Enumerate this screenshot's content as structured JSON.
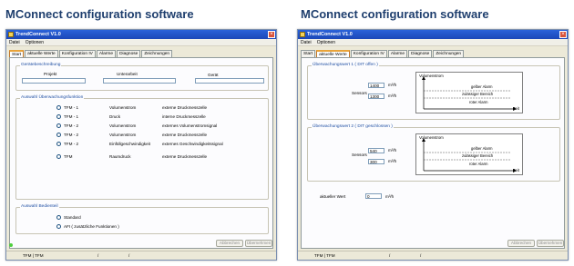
{
  "headings": {
    "left": "MConnect configuration software",
    "right": "MConnect configuration software"
  },
  "app": {
    "title": "TrendConnect V1.0",
    "menu": [
      "Datei",
      "Optionen"
    ],
    "tabs": [
      "Start",
      "aktuelle Werte",
      "Konfiguration IV",
      "Alarme",
      "Diagnose",
      "Zeichnungen"
    ]
  },
  "left": {
    "active_tab": "Start",
    "device_group": {
      "title": "Gerätebeschreibung",
      "fields": [
        {
          "label": "Projekt",
          "value": ""
        },
        {
          "label": "Unterarbeit",
          "value": ""
        },
        {
          "label": "Gerät",
          "value": ""
        }
      ]
    },
    "transducer_group": {
      "title": "Auswahl Überwachungsfunktion",
      "rows": [
        {
          "option": "TFM - 1",
          "type": "Volumenstrom",
          "source": "externe Druckmesszelle"
        },
        {
          "option": "TFM - 1",
          "type": "Druck",
          "source": "interne Druckmesszelle"
        },
        {
          "option": "TFM - 2",
          "type": "Volumenstrom",
          "source": "externes Volumenstromsignal"
        },
        {
          "option": "TFM - 2",
          "type": "Volumenstrom",
          "source": "externe Druckmesszelle"
        },
        {
          "option": "TFM - 2",
          "type": "Einfüllgeschwindigkeit",
          "source": "externes Geschwindigkeitssignal"
        },
        {
          "option": "TFM",
          "type": "Raumdruck",
          "source": "externe Druckmesszelle"
        }
      ]
    },
    "operation_group": {
      "title": "Auswahl Bedienteil",
      "options": [
        "Standard",
        "AFI ( zusätzliche Funktionen )"
      ]
    },
    "buttons": {
      "cancel": "Abbrechen",
      "apply": "Übernehmen"
    },
    "status": {
      "cell1": "TFM | TFM",
      "cell2": "/",
      "cell3": "/"
    }
  },
  "right": {
    "active_tab": "aktuelle Werte",
    "monitor1": {
      "title": "Überwachungswert 1 ( DIT offen )",
      "label": "Sensors",
      "values": [
        {
          "value": "1400",
          "unit": "m³/h"
        },
        {
          "value": "1300",
          "unit": "m³/h"
        }
      ]
    },
    "monitor2": {
      "title": "Überwachungswert 2 ( DIT geschlossen )",
      "label": "Sensors",
      "values": [
        {
          "value": "540",
          "unit": "m³/h"
        },
        {
          "value": "300",
          "unit": "m³/h"
        }
      ]
    },
    "diagram": {
      "y_label": "Volumenstrom",
      "upper": "gelber Alarm",
      "band": "zulässiger Bereich",
      "lower": "roter Alarm",
      "x_label": "Zeit"
    },
    "actual": {
      "label": "aktueller Wert",
      "value": "0",
      "unit": "m³/h"
    },
    "buttons": {
      "cancel": "Abbrechen",
      "apply": "Übernehmen"
    },
    "status": {
      "cell1": "TFM | TFM",
      "cell2": "/",
      "cell3": "/"
    }
  }
}
